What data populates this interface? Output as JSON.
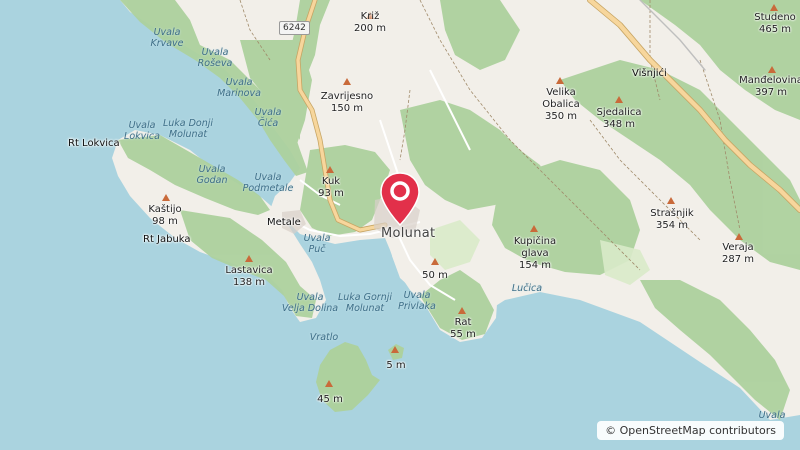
{
  "map": {
    "attribution": "© OpenStreetMap contributors",
    "road_ref": "6242",
    "marker": {
      "name": "Molunat",
      "color": "#e2304a"
    },
    "towns": [
      {
        "id": "molunat",
        "name": "Molunat"
      }
    ],
    "places": [
      {
        "id": "metale",
        "name": "Metale"
      },
      {
        "id": "visnjici",
        "name": "Višnjići"
      },
      {
        "id": "rt-lokvica",
        "name": "Rt Lokvica"
      },
      {
        "id": "rt-jabuka",
        "name": "Rt Jabuka"
      }
    ],
    "peaks": [
      {
        "id": "kriz",
        "name": "Križ",
        "elev": "200 m"
      },
      {
        "id": "studeno",
        "name": "Studeno",
        "elev": "465 m"
      },
      {
        "id": "mandelovina",
        "name": "Manđelovina",
        "elev": "397 m"
      },
      {
        "id": "zavrijesno",
        "name": "Zavrijesno",
        "elev": "150 m"
      },
      {
        "id": "velika-obalica",
        "name": "Velika\nObalica",
        "elev": "350 m"
      },
      {
        "id": "sjedalica",
        "name": "Sjedalica",
        "elev": "348 m"
      },
      {
        "id": "kuk",
        "name": "Kuk",
        "elev": "93 m"
      },
      {
        "id": "kastijo",
        "name": "Kaštijo",
        "elev": "98 m"
      },
      {
        "id": "strasnjik",
        "name": "Strašnjik",
        "elev": "354 m"
      },
      {
        "id": "kupicina-glava",
        "name": "Kupičina\nglava",
        "elev": "154 m"
      },
      {
        "id": "veraja",
        "name": "Veraja",
        "elev": "287 m"
      },
      {
        "id": "lastavica",
        "name": "Lastavica",
        "elev": "138 m"
      },
      {
        "id": "peak-50",
        "name": "",
        "elev": "50 m"
      },
      {
        "id": "rat",
        "name": "Rat",
        "elev": "55 m"
      },
      {
        "id": "islet-5",
        "name": "",
        "elev": "5 m"
      },
      {
        "id": "island-45",
        "name": "",
        "elev": "45 m"
      }
    ],
    "waters": [
      {
        "id": "uvala-krvave",
        "name": "Uvala\nKrvave"
      },
      {
        "id": "uvala-rosevа",
        "name": "Uvala\nRoševa"
      },
      {
        "id": "uvala-marinova",
        "name": "Uvala\nMarinova"
      },
      {
        "id": "uvala-cica",
        "name": "Uvala\nČića"
      },
      {
        "id": "uvala-lokvica",
        "name": "Uvala\nLokvica"
      },
      {
        "id": "luka-donji-molunat",
        "name": "Luka Donji\nMolunat"
      },
      {
        "id": "uvala-godan",
        "name": "Uvala\nGodan"
      },
      {
        "id": "uvala-podmetale",
        "name": "Uvala\nPodmetale"
      },
      {
        "id": "uvala-puc",
        "name": "Uvala\nPuč"
      },
      {
        "id": "uvala-velja-dolina",
        "name": "Uvala\nVelja Dolina"
      },
      {
        "id": "luka-gornji-molunat",
        "name": "Luka Gornji\nMolunat"
      },
      {
        "id": "uvala-privlaka",
        "name": "Uvala\nPrivlaka"
      },
      {
        "id": "lucica",
        "name": "Lučica"
      },
      {
        "id": "vratlo",
        "name": "Vratlo"
      },
      {
        "id": "uvala-corner",
        "name": "Uvala"
      }
    ],
    "colors": {
      "sea": "#aad3df",
      "land": "#f2efe9",
      "forest": "#add19e",
      "road_major": "#f7d69c",
      "peak": "#c96a3a"
    }
  }
}
